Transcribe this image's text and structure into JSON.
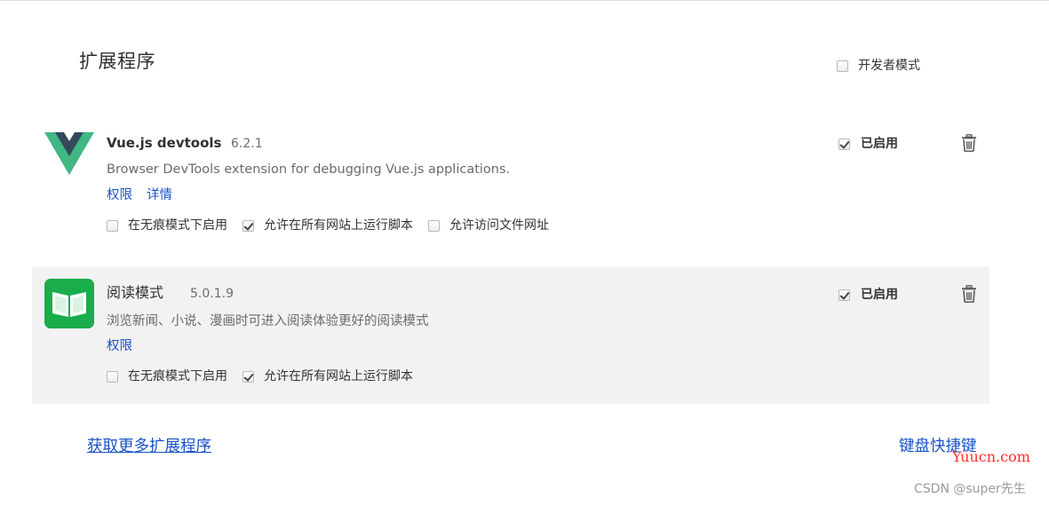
{
  "page": {
    "title": "扩展程序",
    "developer_mode_label": "开发者模式",
    "developer_mode_checked": false
  },
  "extensions": [
    {
      "name": "Vue.js devtools",
      "version": "6.2.1",
      "description": "Browser DevTools extension for debugging Vue.js applications.",
      "links": [
        "权限",
        "详情"
      ],
      "options": [
        {
          "label": "在无痕模式下启用",
          "checked": false
        },
        {
          "label": "允许在所有网站上运行脚本",
          "checked": true
        },
        {
          "label": "允许访问文件网址",
          "checked": false
        }
      ],
      "enabled_label": "已启用",
      "enabled": true,
      "icon": "vue-logo-icon",
      "colors": {
        "logo_outer": "#41b883",
        "logo_inner": "#34495e"
      }
    },
    {
      "name": "阅读模式",
      "version": "5.0.1.9",
      "description": "浏览新闻、小说、漫画时可进入阅读体验更好的阅读模式",
      "links": [
        "权限"
      ],
      "options": [
        {
          "label": "在无痕模式下启用",
          "checked": false
        },
        {
          "label": "允许在所有网站上运行脚本",
          "checked": true
        }
      ],
      "enabled_label": "已启用",
      "enabled": true,
      "icon": "reading-mode-book-icon",
      "colors": {
        "logo_bg": "#1aad4b"
      }
    }
  ],
  "footer": {
    "get_more_label": "获取更多扩展程序",
    "shortcuts_label": "键盘快捷键"
  },
  "watermarks": {
    "site": "Yuucn.com",
    "csdn": "CSDN @super先生"
  },
  "colors": {
    "link": "#1a52c5",
    "row_highlight": "#f2f2f2",
    "watermark_site": "#ff2a2a"
  }
}
